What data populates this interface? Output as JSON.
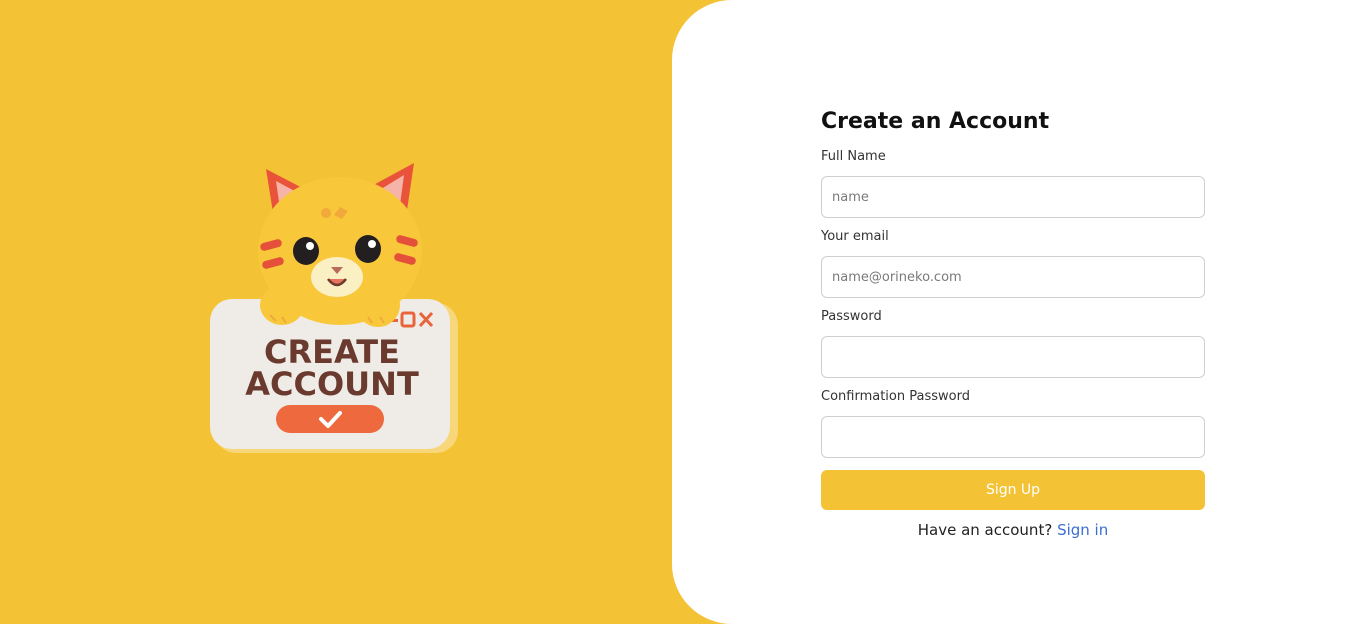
{
  "colors": {
    "background_yellow": "#F3C335",
    "panel_white": "#FFFFFF",
    "button_yellow": "#F3C335",
    "link_blue": "#3B6FD1"
  },
  "illustration": {
    "icon": "cat-holding-create-account-sign-icon",
    "sign_text_line1": "CREATE",
    "sign_text_line2": "ACCOUNT"
  },
  "form": {
    "title": "Create an Account",
    "fields": {
      "full_name": {
        "label": "Full Name",
        "placeholder": "name",
        "value": ""
      },
      "email": {
        "label": "Your email",
        "placeholder": "name@orineko.com",
        "value": ""
      },
      "password": {
        "label": "Password",
        "placeholder": "",
        "value": ""
      },
      "confirm_password": {
        "label": "Confirmation Password",
        "placeholder": "",
        "value": ""
      }
    },
    "submit_label": "Sign Up",
    "signin_prompt": "Have an account?",
    "signin_link": "Sign in"
  }
}
